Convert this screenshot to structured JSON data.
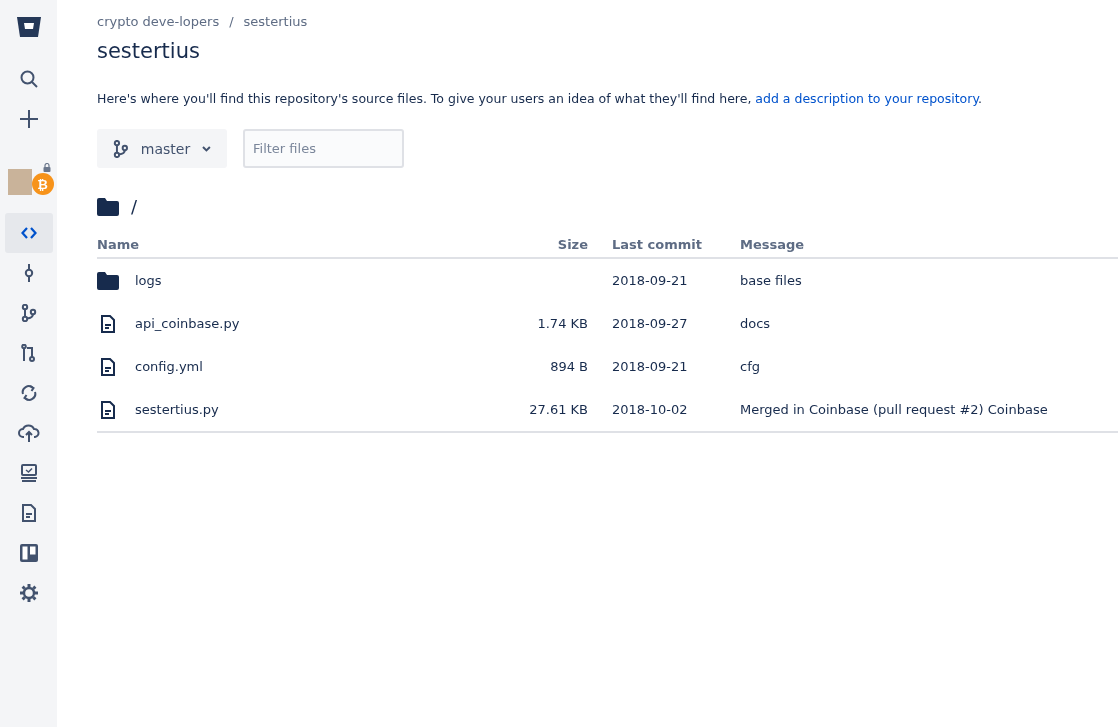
{
  "sidebar": {
    "top": [
      {
        "kind": "search"
      },
      {
        "kind": "create"
      }
    ],
    "repo_avatar": {
      "badge": "₿"
    },
    "nav": [
      {
        "kind": "source",
        "selected": true
      },
      {
        "kind": "commits",
        "selected": false
      },
      {
        "kind": "branches",
        "selected": false
      },
      {
        "kind": "pull-requests",
        "selected": false
      },
      {
        "kind": "pipelines",
        "selected": false
      },
      {
        "kind": "deployments",
        "selected": false
      },
      {
        "kind": "monitor",
        "selected": false
      },
      {
        "kind": "document",
        "selected": false
      },
      {
        "kind": "board",
        "selected": false
      },
      {
        "kind": "settings",
        "selected": false
      }
    ]
  },
  "breadcrumbs": [
    "crypto deve-lopers",
    "sestertius"
  ],
  "breadcrumb_separator": "/",
  "title": "sestertius",
  "description": {
    "text": "Here's where you'll find this repository's source files. To give your users an idea of what they'll find here,",
    "link": "add a description to your repository",
    "end": "."
  },
  "branch": {
    "label": "master"
  },
  "filter": {
    "placeholder": "Filter files"
  },
  "path": "/",
  "table": {
    "columns": [
      "Name",
      "Size",
      "Last commit",
      "Message"
    ],
    "rows": [
      {
        "kind": "folder",
        "name": "logs",
        "size": "",
        "last_commit": "2018-09-21",
        "message": "base files"
      },
      {
        "kind": "file",
        "name": "api_coinbase.py",
        "size": "1.74 KB",
        "last_commit": "2018-09-27",
        "message": "docs"
      },
      {
        "kind": "file",
        "name": "config.yml",
        "size": "894 B",
        "last_commit": "2018-09-21",
        "message": "cfg"
      },
      {
        "kind": "file",
        "name": "sestertius.py",
        "size": "27.61 KB",
        "last_commit": "2018-10-02",
        "message": "Merged in Coinbase (pull request #2) Coinbase"
      }
    ]
  }
}
